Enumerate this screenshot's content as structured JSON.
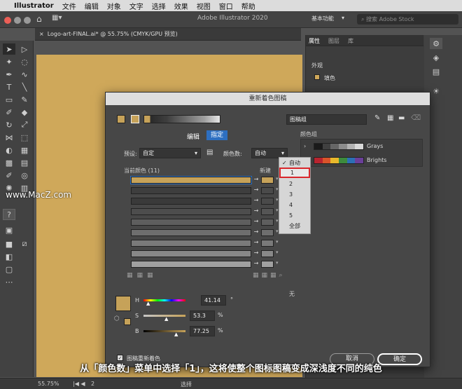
{
  "mac_menu": {
    "app": "Illustrator",
    "items": [
      "文件",
      "编辑",
      "对象",
      "文字",
      "选择",
      "效果",
      "视图",
      "窗口",
      "帮助"
    ]
  },
  "app": {
    "title": "Adobe Illustrator 2020",
    "workspace": "基本功能",
    "search_placeholder": "搜索 Adobe Stock"
  },
  "doc_tab": {
    "label": "Logo-art-FINAL.ai* @ 55.75% (CMYK/GPU 预览)",
    "close": "×"
  },
  "panel": {
    "tabs": [
      "属性",
      "图层",
      "库"
    ],
    "appearance": "外观",
    "fill": "填色"
  },
  "dialog": {
    "title": "重新着色图稿",
    "artwork_group": "图稿组",
    "tabs": {
      "edit": "编辑",
      "assign": "指定"
    },
    "preset_label": "预设:",
    "preset_value": "自定",
    "colors_label": "颜色数:",
    "colors_value": "自动",
    "current_colors": "当前颜色 (11)",
    "new_label": "新建",
    "color_groups_title": "颜色组",
    "groups": [
      {
        "name": "Grays",
        "colors": [
          "#1a1a1a",
          "#404040",
          "#666666",
          "#8c8c8c",
          "#b3b3b3",
          "#d9d9d9"
        ]
      },
      {
        "name": "Brights",
        "colors": [
          "#b8242f",
          "#d9542a",
          "#e8b82c",
          "#3d8b3d",
          "#2c6fb5",
          "#6a3f99"
        ]
      }
    ],
    "rows": [
      {
        "color": "#c6a259",
        "new": "#c6a259",
        "selected": true
      },
      {
        "color": "#3e3e3e",
        "new": "#4a4a4a"
      },
      {
        "color": "#3a3a3a",
        "new": "#4a4a4a"
      },
      {
        "color": "#4d4d4d",
        "new": "#555555"
      },
      {
        "color": "#5e5e5e",
        "new": "#5e5e5e"
      },
      {
        "color": "#6e6e6e",
        "new": "#6e6e6e"
      },
      {
        "color": "#7a7a7a",
        "new": "#7a7a7a"
      },
      {
        "color": "#888888",
        "new": "#888888"
      },
      {
        "color": "#a0a0a0",
        "new": "#a0a0a0"
      }
    ],
    "h_label": "H",
    "h_value": "41.14",
    "h_unit": "°",
    "s_label": "S",
    "s_value": "53.3",
    "s_unit": "%",
    "b_label": "B",
    "b_value": "77.25",
    "b_unit": "%",
    "none_label": "无",
    "recolor_checkbox": "图稿重新着色",
    "cancel": "取消",
    "ok": "确定",
    "current_swatch": "#c6a259"
  },
  "colors_menu": {
    "checked": "✓",
    "items": [
      "自动",
      "1",
      "2",
      "3",
      "4",
      "5",
      "全部"
    ]
  },
  "watermark": "www.MacZ.com",
  "status": {
    "zoom": "55.75%",
    "page": "2",
    "tool": "选择"
  },
  "caption": "从「颜色数」菜单中选择「1」，这将使整个图标图稿变成深浅度不同的纯色",
  "colors": {
    "accent": "#2d6fc1",
    "highlight_border": "#d9262b",
    "caption_text": "#ffffff",
    "artwork": "#cfa85a"
  }
}
